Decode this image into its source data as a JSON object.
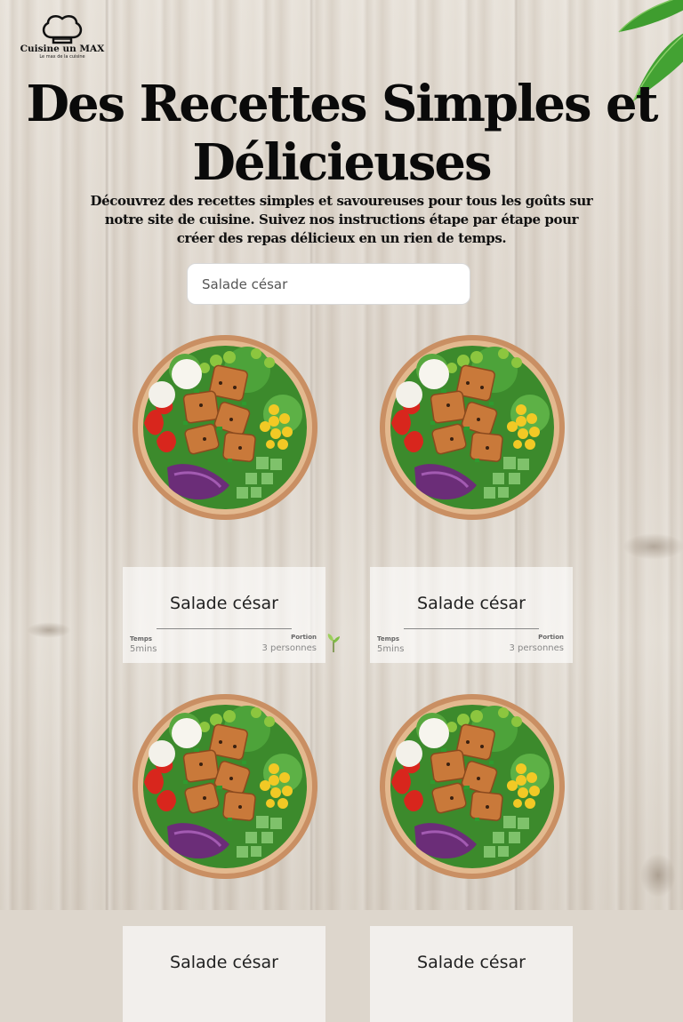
{
  "logo": {
    "name": "Cuisine un MAX",
    "tagline": "Le max de la cuisine"
  },
  "hero": {
    "title": "Des Recettes Simples et Délicieuses",
    "subtitle": "Découvrez des recettes simples et savoureuses pour tous les goûts sur notre site de cuisine. Suivez nos instructions étape par étape pour créer des repas délicieux en un rien de temps."
  },
  "search": {
    "value": "Salade césar"
  },
  "recipes": [
    {
      "name": "Salade césar",
      "time_label": "Temps",
      "time": "5mins",
      "portion_label": "Portion",
      "portion": "3 personnes"
    },
    {
      "name": "Salade césar",
      "time_label": "Temps",
      "time": "5mins",
      "portion_label": "Portion",
      "portion": "3 personnes"
    },
    {
      "name": "Salade césar"
    },
    {
      "name": "Salade césar"
    }
  ],
  "colors": {
    "accent_leaf": "#3f9d2f",
    "title": "#0a0a0a",
    "card_bg": "#ffffff"
  }
}
